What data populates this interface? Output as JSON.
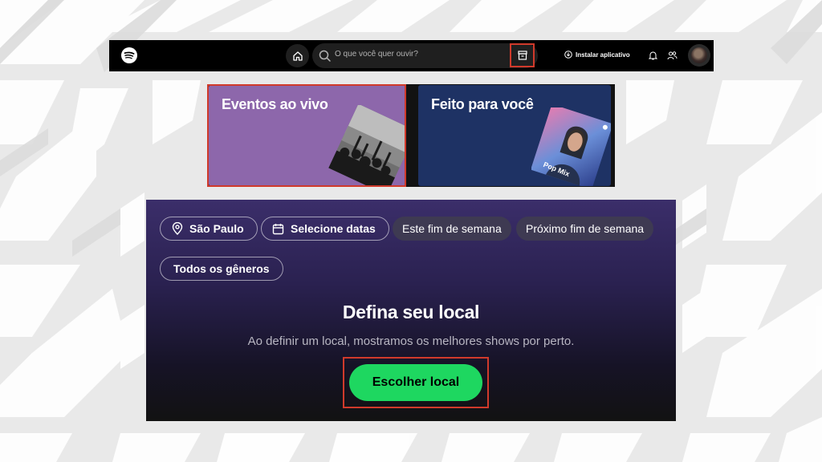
{
  "topbar": {
    "search_placeholder": "O que você quer ouvir?",
    "install_label": "Instalar aplicativo"
  },
  "cards": {
    "events_title": "Eventos ao vivo",
    "foryou_title": "Feito para você",
    "foryou_art_label": "Pop Mix"
  },
  "filters": {
    "city": "São Paulo",
    "dates": "Selecione datas",
    "this_weekend": "Este fim de semana",
    "next_weekend": "Próximo fim de semana",
    "genres": "Todos os gêneros"
  },
  "location_prompt": {
    "heading": "Defina seu local",
    "subtext": "Ao definir um local, mostramos os melhores shows por perto.",
    "button_label": "Escolher local"
  },
  "colors": {
    "accent_green": "#1ed760",
    "highlight_red": "#d03a2b",
    "events_card": "#8d67ab",
    "foryou_card": "#1e3264"
  }
}
